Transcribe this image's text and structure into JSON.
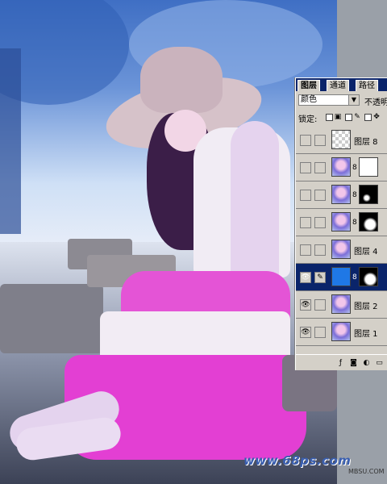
{
  "photo": {
    "description_colors": {
      "sky": "#3f6fc4",
      "skirt": "#e454d6",
      "top": "#f1ecf4"
    }
  },
  "layers_panel": {
    "tabs": [
      {
        "label": "图层",
        "active": true
      },
      {
        "label": "通道",
        "active": false
      },
      {
        "label": "路径",
        "active": false
      }
    ],
    "blend_mode": "颜色",
    "opacity_label": "不透明",
    "lock_label": "锁定:",
    "layers": [
      {
        "name": "图层 8",
        "selected": false
      },
      {
        "name": "",
        "selected": false
      },
      {
        "name": "",
        "selected": false
      },
      {
        "name": "",
        "selected": false
      },
      {
        "name": "图层 4",
        "selected": false
      },
      {
        "name": "",
        "selected": true
      },
      {
        "name": "图层 2",
        "selected": false
      },
      {
        "name": "图层 1",
        "selected": false
      }
    ]
  },
  "watermark": {
    "text": "www.68ps.com",
    "corner": "MBSU.COM"
  },
  "colors": {
    "panel_bg": "#d4d0c8",
    "selected": "#0a246a",
    "accent_blue": "#1f78e6"
  }
}
